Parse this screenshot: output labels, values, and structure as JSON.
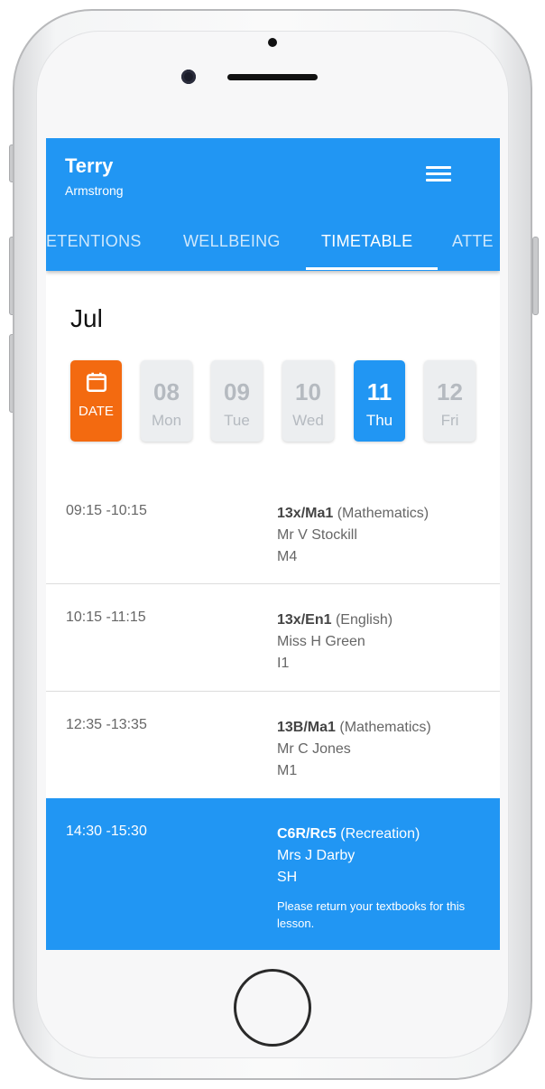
{
  "user": {
    "first_name": "Terry",
    "last_name": "Armstrong"
  },
  "menu_icon": "hamburger-menu-icon",
  "tabs": [
    {
      "label": "ETENTIONS",
      "active": false
    },
    {
      "label": "WELLBEING",
      "active": false
    },
    {
      "label": "TIMETABLE",
      "active": true
    },
    {
      "label": "ATTE",
      "active": false
    }
  ],
  "month": "Jul",
  "date_button": {
    "icon": "calendar-icon",
    "label": "DATE"
  },
  "days": [
    {
      "num": "08",
      "dow": "Mon",
      "selected": false
    },
    {
      "num": "09",
      "dow": "Tue",
      "selected": false
    },
    {
      "num": "10",
      "dow": "Wed",
      "selected": false
    },
    {
      "num": "11",
      "dow": "Thu",
      "selected": true
    },
    {
      "num": "12",
      "dow": "Fri",
      "selected": false
    }
  ],
  "lessons": [
    {
      "time": "09:15 -10:15",
      "code": "13x/Ma1",
      "subject": "(Mathematics)",
      "teacher": "Mr V Stockill",
      "room": "M4",
      "note": "",
      "highlight": false
    },
    {
      "time": "10:15 -11:15",
      "code": "13x/En1",
      "subject": "(English)",
      "teacher": "Miss H Green",
      "room": "I1",
      "note": "",
      "highlight": false
    },
    {
      "time": "12:35 -13:35",
      "code": "13B/Ma1",
      "subject": "(Mathematics)",
      "teacher": "Mr C Jones",
      "room": "M1",
      "note": "",
      "highlight": false
    },
    {
      "time": "14:30 -15:30",
      "code": "C6R/Rc5",
      "subject": "(Recreation)",
      "teacher": "Mrs J Darby",
      "room": "SH",
      "note": "Please return your textbooks for this lesson.",
      "highlight": true
    }
  ],
  "colors": {
    "primary": "#2196f3",
    "date_button": "#f36a10"
  }
}
